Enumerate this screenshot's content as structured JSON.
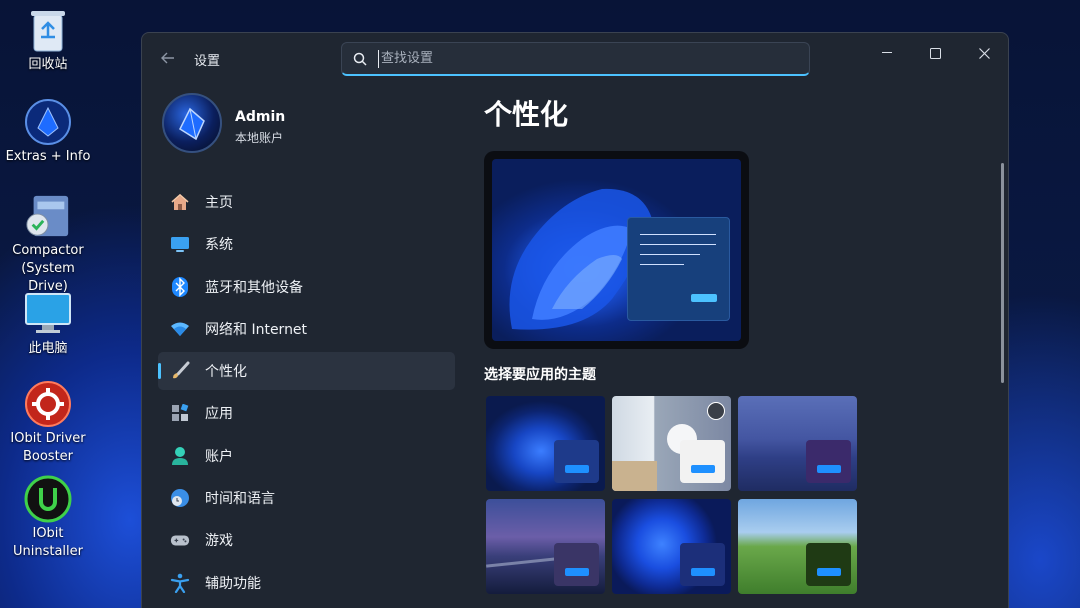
{
  "desktop": {
    "icons": [
      {
        "label": "回收站",
        "icon": "recycle-bin-icon"
      },
      {
        "label": "Extras + Info",
        "icon": "extras-info-icon"
      },
      {
        "label": "Compactor (System Drive)",
        "icon": "compactor-icon"
      },
      {
        "label": "此电脑",
        "icon": "this-pc-icon"
      },
      {
        "label": "IObit Driver Booster",
        "icon": "driver-booster-icon"
      },
      {
        "label": "IObit Uninstaller",
        "icon": "iobit-uninstaller-icon"
      }
    ]
  },
  "window": {
    "title": "设置",
    "search": {
      "placeholder": "查找设置",
      "value": ""
    },
    "controls": {
      "minimize": "—",
      "maximize": "☐",
      "close": "✕"
    }
  },
  "profile": {
    "name": "Admin",
    "type": "本地账户"
  },
  "nav": {
    "items": [
      {
        "label": "主页",
        "icon": "home-icon",
        "active": false
      },
      {
        "label": "系统",
        "icon": "system-monitor-icon",
        "active": false
      },
      {
        "label": "蓝牙和其他设备",
        "icon": "bluetooth-icon",
        "active": false
      },
      {
        "label": "网络和 Internet",
        "icon": "wifi-icon",
        "active": false
      },
      {
        "label": "个性化",
        "icon": "paintbrush-icon",
        "active": true
      },
      {
        "label": "应用",
        "icon": "apps-icon",
        "active": false
      },
      {
        "label": "账户",
        "icon": "account-icon",
        "active": false
      },
      {
        "label": "时间和语言",
        "icon": "time-language-icon",
        "active": false
      },
      {
        "label": "游戏",
        "icon": "gamepad-icon",
        "active": false
      },
      {
        "label": "辅助功能",
        "icon": "accessibility-icon",
        "active": false
      }
    ]
  },
  "content": {
    "title": "个性化",
    "themes_heading": "选择要应用的主题",
    "themes": [
      {
        "name": "windows-bloom-dark",
        "accent": "#1e3a8a"
      },
      {
        "name": "captured-motion",
        "accent": "#f2f2f2"
      },
      {
        "name": "glow",
        "accent": "#3b2a6b"
      },
      {
        "name": "sunrise-pier",
        "accent": "#3a3566"
      },
      {
        "name": "windows-bloom-blue",
        "accent": "#1c2f7a"
      },
      {
        "name": "bliss",
        "accent": "#1f3a14"
      }
    ]
  },
  "colors": {
    "accent": "#4cc2ff",
    "window_bg": "#1f2631"
  }
}
